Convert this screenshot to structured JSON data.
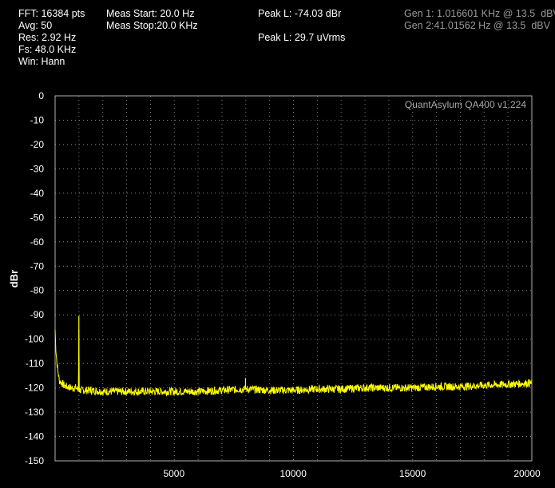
{
  "header": {
    "fft": "FFT: 16384 pts",
    "avg": "Avg: 50",
    "res": "Res: 2.92 Hz",
    "fs": "Fs: 48.0 KHz",
    "win": "Win: Hann",
    "meas_start": "Meas Start: 20.0 Hz",
    "meas_stop": "Meas Stop:20.0 KHz",
    "peak_dbr": "Peak L: -74.03 dBr",
    "peak_vrms": "Peak L: 29.7 uVrms",
    "gen1": "Gen 1: 1.016601 KHz @ 13.5  dBV",
    "gen2": "Gen 2:41.01562 Hz @ 13.5  dBV"
  },
  "watermark": "QuantAsylum QA400 v1.224",
  "colors": {
    "trace": "#ffff00",
    "grid": "#8a8a8a",
    "background": "#000000",
    "text": "#ffffff",
    "gen_text": "#9a9a9a"
  },
  "chart_data": {
    "type": "line",
    "title": "",
    "xlabel": "",
    "ylabel": "dBr",
    "xlim": [
      20,
      20000
    ],
    "ylim": [
      -150,
      0
    ],
    "x_ticks": [
      5000,
      10000,
      15000,
      20000
    ],
    "y_ticks": [
      0,
      -10,
      -20,
      -30,
      -40,
      -50,
      -60,
      -70,
      -80,
      -90,
      -100,
      -110,
      -120,
      -130,
      -140,
      -150
    ],
    "grid": true,
    "series": [
      {
        "x": [
          20,
          50,
          100,
          150,
          200,
          300,
          400,
          500,
          700,
          900,
          1000,
          1016.6,
          1030,
          1200,
          1500,
          2000,
          3000,
          4000,
          5000,
          6000,
          7000,
          8000,
          9000,
          10000,
          11000,
          12000,
          13000,
          14000,
          15000,
          16000,
          17000,
          18000,
          19000,
          20000
        ],
        "y": [
          -96,
          -104,
          -110,
          -114,
          -117,
          -118,
          -119,
          -119.5,
          -120,
          -120,
          -121,
          -90.5,
          -121,
          -121,
          -121,
          -121.5,
          -121.5,
          -121.5,
          -121.5,
          -121.5,
          -121,
          -120.5,
          -121,
          -121,
          -120.5,
          -120.5,
          -120,
          -120,
          -120,
          -119.5,
          -119.5,
          -119,
          -118.5,
          -118
        ]
      }
    ],
    "spikes": [
      {
        "x": 1016.6,
        "y": -90.5
      },
      {
        "x": 8000,
        "y": -116
      }
    ]
  }
}
